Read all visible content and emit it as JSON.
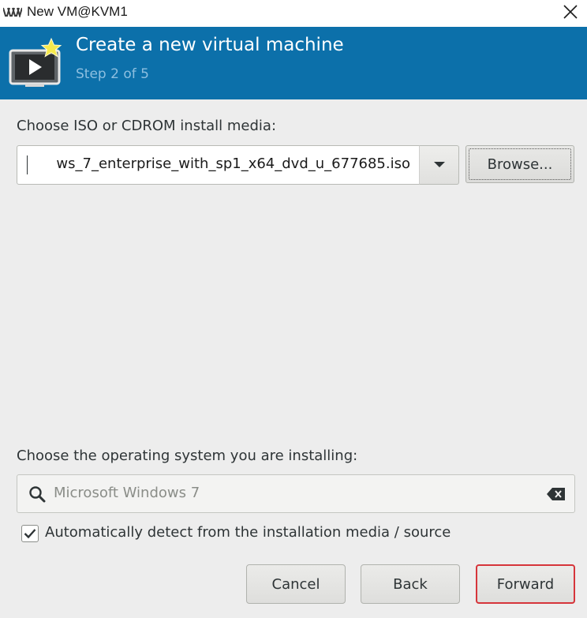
{
  "window": {
    "title": "New VM@KVM1",
    "logo_icon": "virt-manager-logo",
    "close_icon": "close-x-icon"
  },
  "banner": {
    "title": "Create a new virtual machine",
    "step": "Step 2 of 5",
    "icon": "new-vm-monitor-icon",
    "color": "#0c70aa"
  },
  "install_media": {
    "label": "Choose ISO or CDROM install media:",
    "value": "ws_7_enterprise_with_sp1_x64_dvd_u_677685.iso",
    "dropdown_icon": "caret-down-icon",
    "browse_label": "Browse..."
  },
  "os_selection": {
    "label": "Choose the operating system you are installing:",
    "search_value": "Microsoft Windows 7",
    "search_icon": "search-icon",
    "clear_icon": "clear-backspace-icon"
  },
  "auto_detect": {
    "checked": true,
    "label": "Automatically detect from the installation media / source"
  },
  "buttons": {
    "cancel": "Cancel",
    "back": "Back",
    "forward": "Forward",
    "forward_highlight": "#d6353b"
  }
}
